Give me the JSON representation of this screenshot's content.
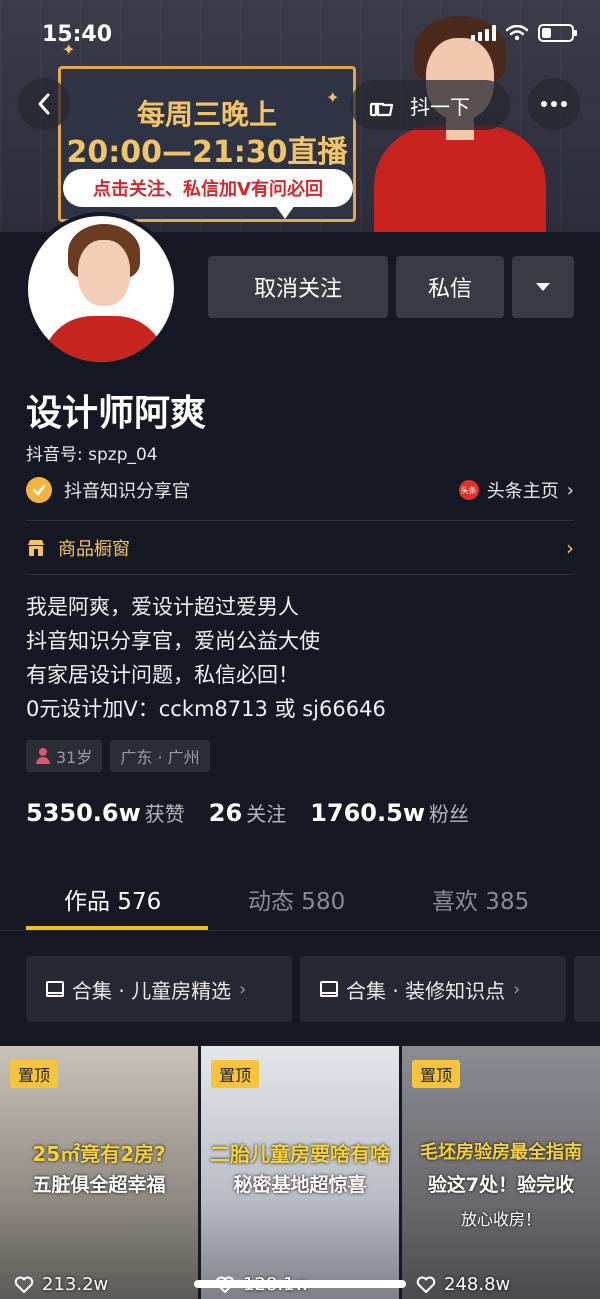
{
  "status_bar": {
    "time": "15:40"
  },
  "banner": {
    "line1": "每周三晚上",
    "line2": "20:00—21:30直播",
    "pill": "点击关注、私信加V有问必回"
  },
  "header": {
    "poke_label": "抖一下"
  },
  "actions": {
    "unfollow": "取消关注",
    "message": "私信"
  },
  "profile": {
    "name": "设计师阿爽",
    "douyin_id": "抖音号: spzp_04",
    "verification": "抖音知识分享官",
    "toutiao_logo": "头条",
    "toutiao_link": "头条主页",
    "shop": "商品橱窗",
    "bio": [
      "我是阿爽，爱设计超过爱男人",
      "抖音知识分享官，爱尚公益大使",
      "有家居设计问题，私信必回！",
      "0元设计加V：cckm8713 或 sj66646"
    ],
    "tags": [
      "31岁",
      "广东 · 广州"
    ]
  },
  "stats": [
    {
      "value": "5350.6w",
      "label": "获赞"
    },
    {
      "value": "26",
      "label": "关注"
    },
    {
      "value": "1760.5w",
      "label": "粉丝"
    }
  ],
  "tabs": [
    {
      "label": "作品 576",
      "active": true
    },
    {
      "label": "动态 580",
      "active": false
    },
    {
      "label": "喜欢 385",
      "active": false
    }
  ],
  "collections": [
    {
      "label": "合集 · 儿童房精选"
    },
    {
      "label": "合集 · 装修知识点"
    }
  ],
  "videos": [
    {
      "pin": "置顶",
      "caption1": "25㎡竟有2房?",
      "caption2": "五脏俱全超幸福",
      "caption3": "",
      "likes": "213.2w"
    },
    {
      "pin": "置顶",
      "caption1": "二胎儿童房要啥有啥",
      "caption2": "秘密基地超惊喜",
      "caption3": "",
      "likes": "128.1w"
    },
    {
      "pin": "置顶",
      "caption1": "毛坯房验房最全指南",
      "caption2": "验这7处！验完收",
      "caption3": "放心收房！",
      "likes": "248.8w"
    }
  ],
  "colors": {
    "background": "#161823",
    "accent_yellow": "#f2c01e",
    "button_gray": "#393b44",
    "shop_gold": "#f2c46a"
  },
  "icons": [
    "back-icon",
    "poke-hand-icon",
    "more-icon",
    "dropdown-icon",
    "verified-icon",
    "toutiao-icon",
    "shop-icon",
    "person-icon",
    "layers-icon",
    "chevron-right-icon",
    "heart-icon"
  ]
}
